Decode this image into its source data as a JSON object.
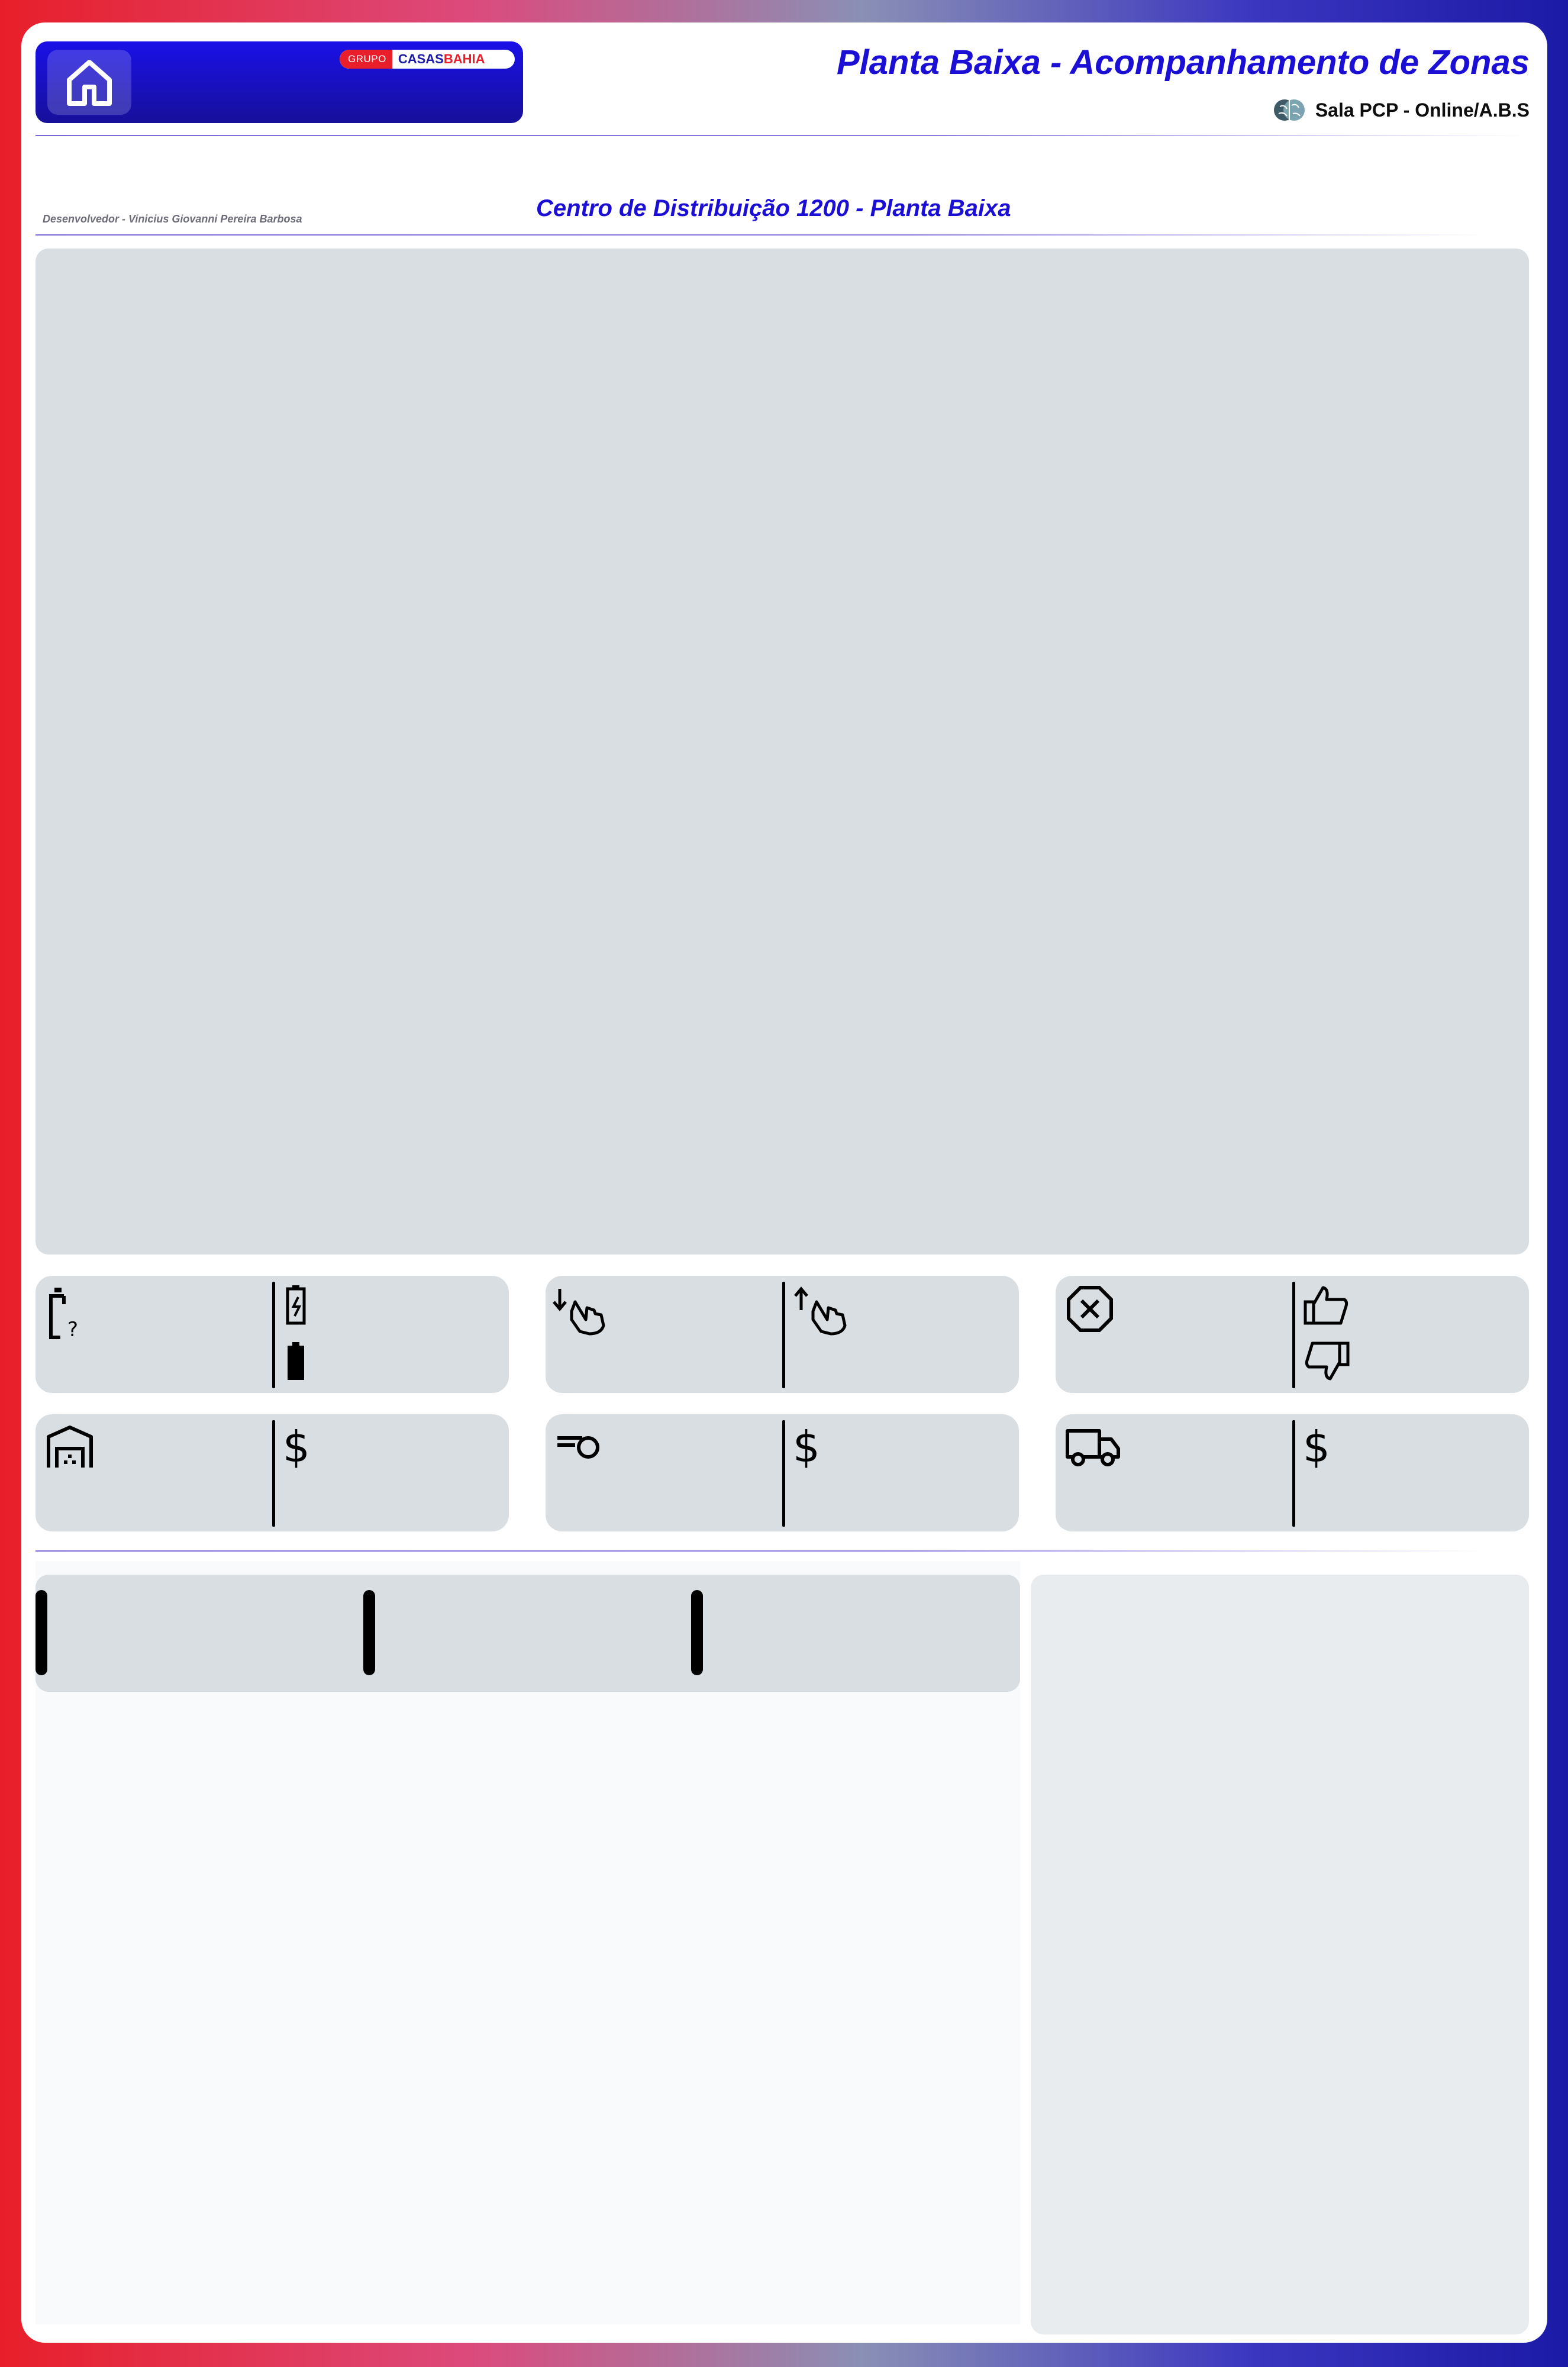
{
  "header": {
    "title": "Planta Baixa - Acompanhamento de Zonas",
    "subtitle": "Sala PCP - Online/A.B.S",
    "brand": {
      "grupo": "GRUPO",
      "casas": "CASAS",
      "bahia": "BAHIA"
    },
    "home_icon": "home-icon",
    "brain_icon": "brain-icon"
  },
  "section": {
    "developer": "Desenvolvedor - Vinicius Giovanni Pereira Barbosa",
    "title": "Centro de Distribuição 1200  - Planta Baixa"
  },
  "kpi_cards": [
    {
      "left_icon": "battery-unknown-icon",
      "right_icons": [
        "battery-charging-icon",
        "battery-full-icon"
      ]
    },
    {
      "left_icon": "swipe-down-hand-icon",
      "right_icons": [
        "swipe-up-hand-icon"
      ]
    },
    {
      "left_icon": "cancel-octagon-icon",
      "right_icons": [
        "thumbs-up-icon",
        "thumbs-down-icon"
      ]
    },
    {
      "left_icon": "warehouse-icon",
      "right_icons": [
        "dollar-icon"
      ]
    },
    {
      "left_icon": "fast-tag-icon",
      "right_icons": [
        "dollar-icon"
      ]
    },
    {
      "left_icon": "truck-icon",
      "right_icons": [
        "dollar-icon"
      ]
    }
  ],
  "colors": {
    "accent": "#1b0fd6",
    "brand_red": "#e81f2a",
    "brand_blue": "#1b1aa6",
    "panel": "#d8dee2"
  }
}
